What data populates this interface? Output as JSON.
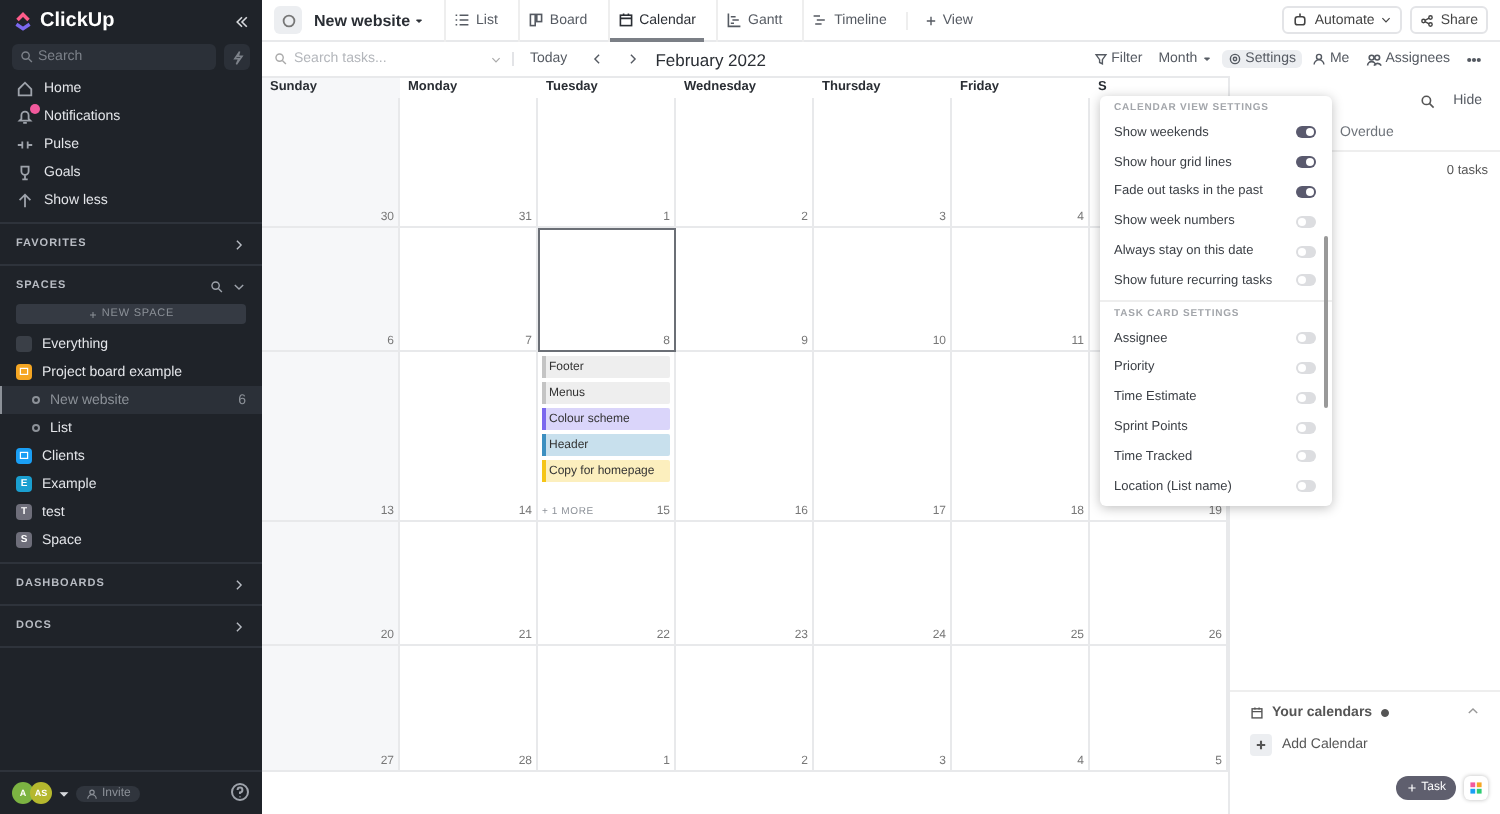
{
  "sidebar": {
    "logo": "ClickUp",
    "search": {
      "placeholder": "Search"
    },
    "nav": [
      {
        "label": "Home",
        "alert": false
      },
      {
        "label": "Notifications",
        "alert": true
      },
      {
        "label": "Pulse",
        "alert": false
      },
      {
        "label": "Goals",
        "alert": false
      },
      {
        "label": "Show less",
        "alert": false
      }
    ],
    "favorites": "FAVORITES",
    "spaces_title": "SPACES",
    "new_space": "NEW SPACE",
    "spaces": [
      {
        "label": "Everything",
        "kind": "all",
        "selected": false
      },
      {
        "label": "Project board example",
        "kind": "space",
        "color": "#f5a623",
        "selected": false,
        "children": [
          {
            "label": "New website",
            "kind": "list",
            "selected": true,
            "count": "6"
          },
          {
            "label": "List",
            "kind": "list",
            "selected": false
          }
        ]
      },
      {
        "label": "Clients",
        "kind": "space",
        "color": "#1a9ff5",
        "selected": false
      },
      {
        "label": "Example",
        "kind": "letter",
        "initial": "E",
        "color": "#1a9fd0",
        "selected": false
      },
      {
        "label": "test",
        "kind": "letter",
        "initial": "T",
        "color": "#6e6e7a",
        "selected": false
      },
      {
        "label": "Space",
        "kind": "letter",
        "initial": "S",
        "color": "#6e6e7a",
        "selected": false
      }
    ],
    "dashboards": "DASHBOARDS",
    "docs": "DOCS",
    "avatars": [
      {
        "initials": "A",
        "color": "#7cb342"
      },
      {
        "initials": "AS",
        "color": "#b5b82e"
      }
    ],
    "invite": "Invite"
  },
  "header": {
    "title": "New website",
    "views": [
      {
        "label": "List",
        "selected": false
      },
      {
        "label": "Board",
        "selected": false
      },
      {
        "label": "Calendar",
        "selected": true
      },
      {
        "label": "Gantt",
        "selected": false
      },
      {
        "label": "Timeline",
        "selected": false
      }
    ],
    "add_view": "View",
    "automate": "Automate",
    "share": "Share"
  },
  "toolbar": {
    "search": {
      "placeholder": "Search tasks..."
    },
    "today": "Today",
    "period": "February 2022",
    "filter": "Filter",
    "mode": "Month",
    "settings": {
      "label": "Settings",
      "selected": true
    },
    "me": "Me",
    "assignees": "Assignees"
  },
  "calendar": {
    "weekdays": [
      "Sunday",
      "Monday",
      "Tuesday",
      "Wednesday",
      "Thursday",
      "Friday",
      "S"
    ],
    "weeks": [
      [
        {
          "day": "30",
          "selected": false
        },
        {
          "day": "31",
          "selected": false
        },
        {
          "day": "1",
          "selected": false
        },
        {
          "day": "2",
          "selected": false
        },
        {
          "day": "3",
          "selected": false
        },
        {
          "day": "4",
          "selected": false
        },
        {
          "selected": false
        }
      ],
      [
        {
          "day": "6",
          "selected": false
        },
        {
          "day": "7",
          "selected": false
        },
        {
          "day": "8",
          "selected": true
        },
        {
          "day": "9",
          "selected": false
        },
        {
          "day": "10",
          "selected": false
        },
        {
          "day": "11",
          "selected": false
        },
        {
          "selected": false
        }
      ],
      [
        {
          "day": "13",
          "selected": false
        },
        {
          "day": "14",
          "selected": false
        },
        {
          "day": "15",
          "selected": false,
          "more": "+ 1 MORE",
          "tasks": [
            {
              "name": "Footer",
              "color": "#c4c4c4"
            },
            {
              "name": "Menus",
              "color": "#c4c4c4"
            },
            {
              "name": "Colour scheme",
              "color": "#7b68ee"
            },
            {
              "name": "Header",
              "color": "#3b8fc0"
            },
            {
              "name": "Copy for homepage",
              "color": "#f5c518"
            }
          ]
        },
        {
          "day": "16",
          "selected": false
        },
        {
          "day": "17",
          "selected": false
        },
        {
          "day": "18",
          "selected": false
        },
        {
          "day": "19",
          "selected": false
        }
      ],
      [
        {
          "day": "20",
          "selected": false
        },
        {
          "day": "21",
          "selected": false
        },
        {
          "day": "22",
          "selected": false
        },
        {
          "day": "23",
          "selected": false
        },
        {
          "day": "24",
          "selected": false
        },
        {
          "day": "25",
          "selected": false
        },
        {
          "day": "26",
          "selected": false
        }
      ],
      [
        {
          "day": "27",
          "selected": false
        },
        {
          "day": "28",
          "selected": false
        },
        {
          "day": "1",
          "selected": false
        },
        {
          "day": "2",
          "selected": false
        },
        {
          "day": "3",
          "selected": false
        },
        {
          "day": "4",
          "selected": false
        },
        {
          "day": "5",
          "selected": false
        }
      ]
    ]
  },
  "settings_menu": {
    "sections": [
      {
        "title": "CALENDAR VIEW SETTINGS",
        "options": [
          {
            "label": "Show weekends",
            "on": true
          },
          {
            "label": "Show hour grid lines",
            "on": true
          },
          {
            "label": "Fade out tasks in the past",
            "on": true
          },
          {
            "label": "Show week numbers",
            "on": false
          },
          {
            "label": "Always stay on this date",
            "on": false
          },
          {
            "label": "Show future recurring tasks",
            "on": false
          }
        ]
      },
      {
        "title": "TASK CARD SETTINGS",
        "options": [
          {
            "label": "Assignee",
            "on": false
          },
          {
            "label": "Priority",
            "on": false
          },
          {
            "label": "Time Estimate",
            "on": false
          },
          {
            "label": "Sprint Points",
            "on": false
          },
          {
            "label": "Time Tracked",
            "on": false
          },
          {
            "label": "Location (List name)",
            "on": false
          }
        ]
      }
    ]
  },
  "side_panel": {
    "hide": "Hide",
    "tabs": [
      {
        "label": "Overdue",
        "selected": false
      }
    ],
    "count": "0 tasks",
    "calendars_title": "Your calendars",
    "add_calendar": "Add Calendar"
  },
  "fab": {
    "label": "Task"
  }
}
